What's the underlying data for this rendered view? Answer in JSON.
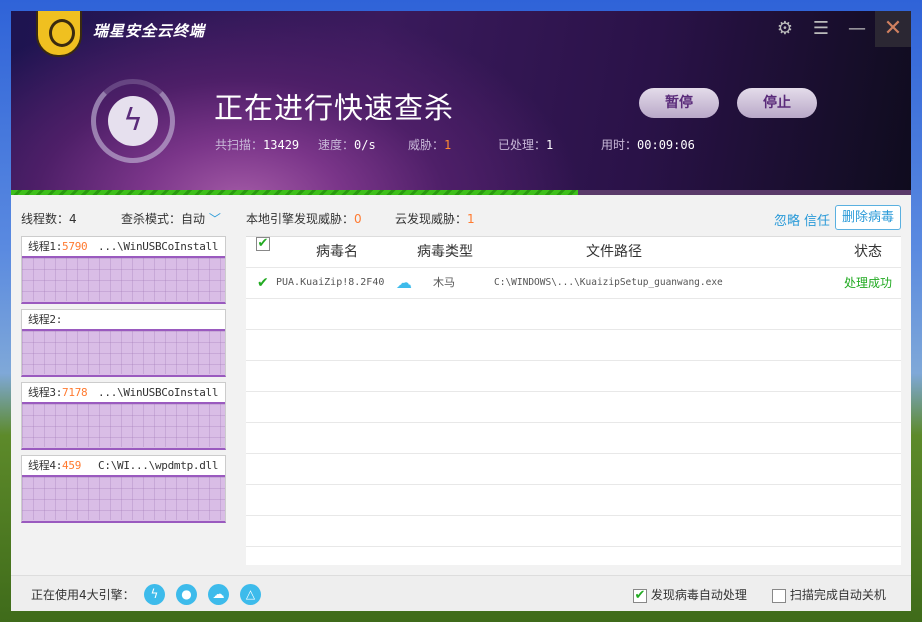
{
  "app": {
    "brand": "瑞星安全云终端"
  },
  "scan": {
    "title": "正在进行快速查杀",
    "scanned_label": "共扫描：",
    "scanned": "13429",
    "speed_label": "速度：",
    "speed": "0/s",
    "threat_label": "威胁：",
    "threat": "1",
    "handled_label": "已处理：",
    "handled": "1",
    "time_label": "用时：",
    "time": "00:09:06",
    "progress_percent": 63,
    "pause": "暂停",
    "stop": "停止"
  },
  "left": {
    "threads_label": "线程数：",
    "threads": "4",
    "mode_label": "查杀模式：",
    "mode": "自动",
    "items": [
      {
        "label": "线程1:",
        "count": "5790",
        "path": "...\\WinUSBCoInstall"
      },
      {
        "label": "线程2:",
        "count": "",
        "path": ""
      },
      {
        "label": "线程3:",
        "count": "7178",
        "path": "...\\WinUSBCoInstall"
      },
      {
        "label": "线程4:",
        "count": "459",
        "path": "C:\\WI...\\wpdmtp.dll"
      }
    ]
  },
  "main": {
    "local_label": "本地引擎发现威胁：",
    "local": "0",
    "cloud_label": "云发现威胁：",
    "cloud": "1",
    "ignore": "忽略",
    "trust": "信任",
    "delete": "删除病毒",
    "columns": [
      "病毒名",
      "病毒类型",
      "文件路径",
      "状态"
    ],
    "rows": [
      {
        "name": "PUA.KuaiZip!8.2F40",
        "type": "木马",
        "path": "C:\\WINDOWS\\...\\KuaizipSetup_guanwang.exe",
        "status": "处理成功"
      }
    ]
  },
  "footer": {
    "engines_label": "正在使用4大引擎：",
    "auto_handle": "发现病毒自动处理",
    "auto_shutdown": "扫描完成自动关机"
  },
  "colors": {
    "accent": "#2a9ad8",
    "orange": "#ff7a30",
    "success": "#22aa22",
    "thread_fill": "#d9bde6"
  }
}
